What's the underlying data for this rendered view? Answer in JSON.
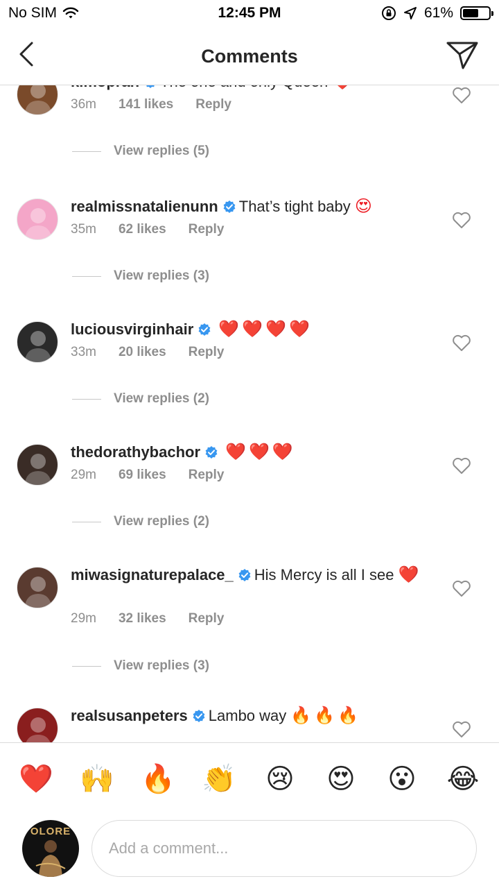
{
  "status_bar": {
    "carrier": "No SIM",
    "time": "12:45 PM",
    "battery": "61%",
    "battery_level": 0.61
  },
  "nav": {
    "title": "Comments",
    "back_icon": "chevron-left-icon",
    "send_icon": "paper-plane-icon"
  },
  "comments": [
    {
      "username": "kimoprah",
      "text": "The one and only Queen",
      "emoji": "❤️",
      "time": "36m",
      "likes": "141 likes",
      "reply": "Reply",
      "view_replies": "View replies (5)",
      "avatar_color": "#7a4a2a"
    },
    {
      "username": "realmissnatalienunn",
      "text": "That’s tight baby",
      "emoji": "😍",
      "time": "35m",
      "likes": "62 likes",
      "reply": "Reply",
      "view_replies": "View replies (3)",
      "avatar_color": "#f4a6c8"
    },
    {
      "username": "luciousvirginhair",
      "text": "",
      "emoji": "❤️❤️❤️❤️",
      "time": "33m",
      "likes": "20 likes",
      "reply": "Reply",
      "view_replies": "View replies (2)",
      "avatar_color": "#2a2a2a"
    },
    {
      "username": "thedorathybachor",
      "text": "",
      "emoji": "❤️❤️❤️",
      "time": "29m",
      "likes": "69 likes",
      "reply": "Reply",
      "view_replies": "View replies (2)",
      "avatar_color": "#3a2c26"
    },
    {
      "username": "miwasignaturepalace_",
      "text": "His Mercy is all I see",
      "emoji": "❤️",
      "time": "29m",
      "likes": "32 likes",
      "reply": "Reply",
      "view_replies": "View replies (3)",
      "avatar_color": "#5a3b30"
    },
    {
      "username": "realsusanpeters",
      "text": "Lambo way",
      "emoji": "🔥🔥🔥",
      "time": "",
      "likes": "",
      "reply": "",
      "view_replies": "",
      "avatar_color": "#8a1e1e"
    }
  ],
  "reactions": [
    "❤️",
    "🙌",
    "🔥",
    "👏",
    "😢",
    "😍",
    "😮",
    "😂"
  ],
  "composer": {
    "placeholder": "Add a comment...",
    "avatar_text": "OLORE"
  },
  "colors": {
    "text": "#262626",
    "secondary": "#8e8e8e",
    "verified": "#3897f0",
    "heart": "#ed1c24"
  }
}
